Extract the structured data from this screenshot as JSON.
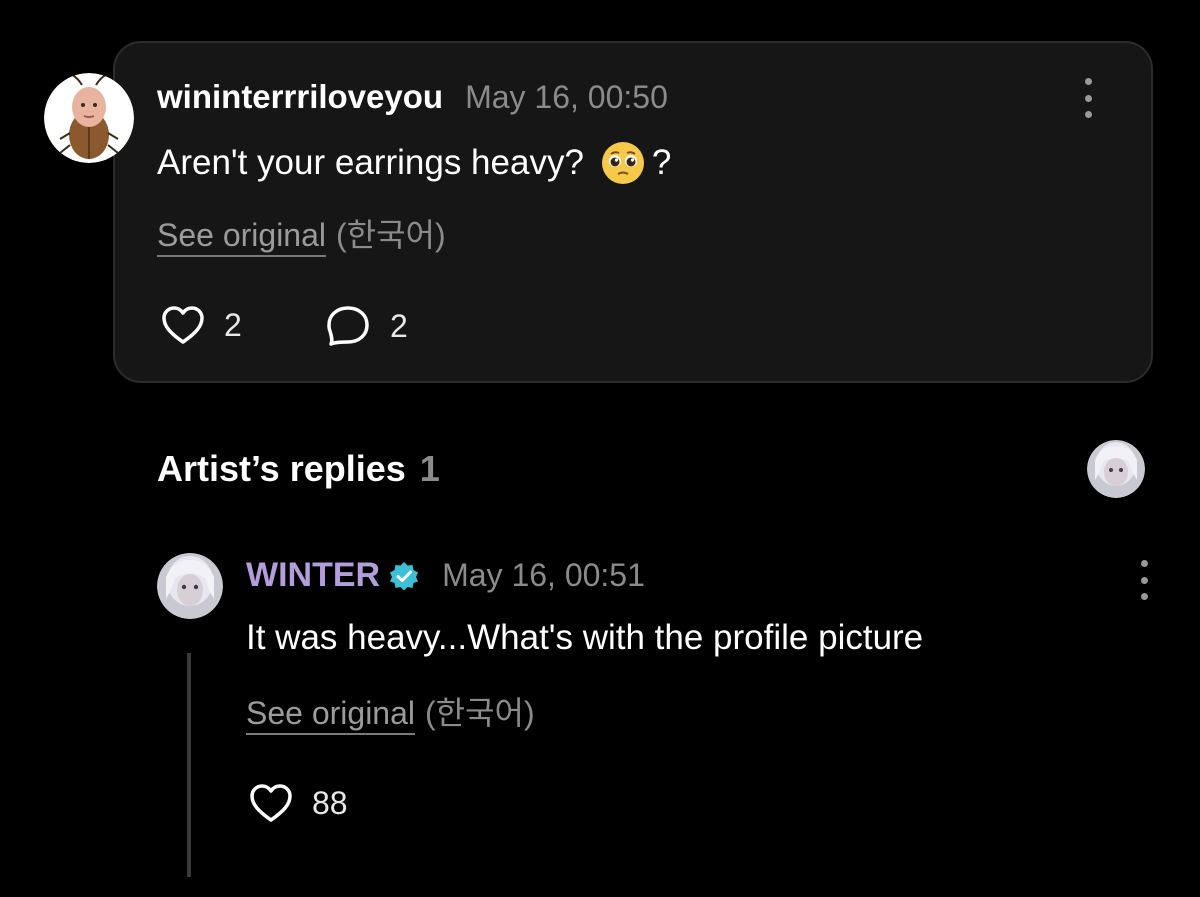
{
  "fan_comment": {
    "username": "wininterrriloveyou",
    "timestamp": "May 16, 00:50",
    "text": "Aren't your earrings heavy?",
    "text_suffix": "?",
    "emoji": "pleading-face",
    "see_original_label": "See original",
    "language": "(한국어)",
    "like_count": "2",
    "reply_count": "2"
  },
  "artist_replies": {
    "title": "Artist’s replies",
    "count": "1"
  },
  "artist_reply": {
    "username": "WINTER",
    "verified": true,
    "timestamp": "May 16, 00:51",
    "text": "It was heavy...What's with the profile picture",
    "see_original_label": "See original",
    "language": "(한국어)",
    "like_count": "88"
  },
  "colors": {
    "background": "#000000",
    "card_background": "#161616",
    "artist_name": "#b39ddb",
    "verified_badge": "#3cc0d8",
    "muted_text": "#8b8b8b"
  },
  "icons": {
    "like": "heart-outline-icon",
    "reply": "speech-bubble-outline-icon",
    "more": "vertical-dots-icon",
    "verified": "verified-badge-icon"
  }
}
